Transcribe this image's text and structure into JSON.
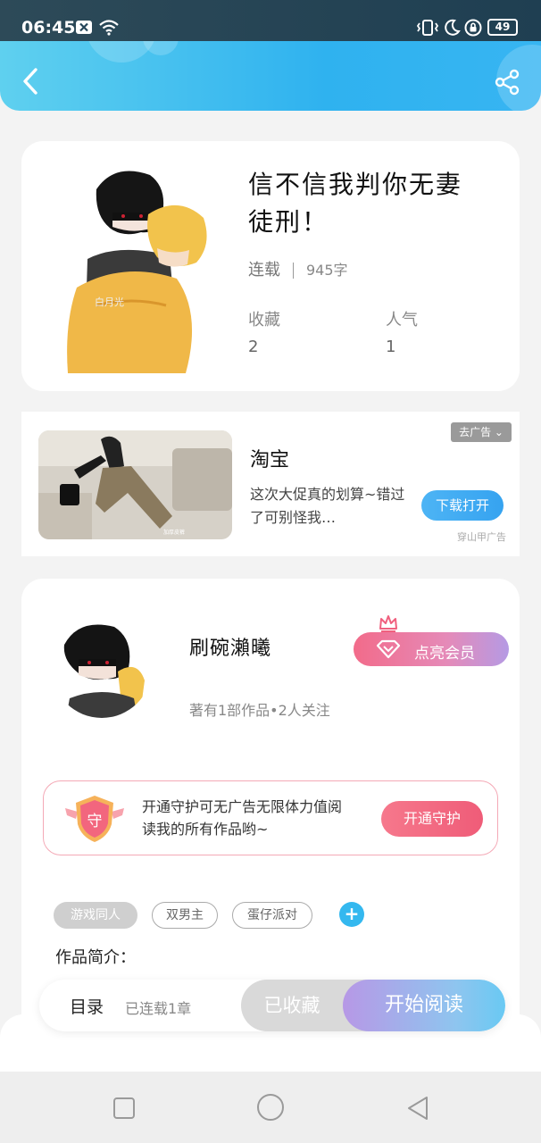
{
  "status_bar": {
    "time": "06:45",
    "battery": "49",
    "icons": [
      "close-box-icon",
      "wifi-icon",
      "vibrate-icon",
      "moon-icon",
      "lock-icon",
      "battery-icon"
    ]
  },
  "header": {
    "back_icon": "chevron-left-icon",
    "share_icon": "share-icon"
  },
  "book": {
    "title_line1": "信不信我判你无妻",
    "title_line2": "徒刑！",
    "status": "连载",
    "word_count": "945字",
    "favorites_label": "收藏",
    "favorites_value": "2",
    "popularity_label": "人气",
    "popularity_value": "1"
  },
  "ad": {
    "close_label": "去广告 ⌄",
    "title": "淘宝",
    "desc": "这次大促真的划算~错过了可别怪我…",
    "button": "下载打开",
    "source": "穿山甲广告"
  },
  "author": {
    "name": "刷碗瀨曦",
    "info": "著有1部作品•2人关注",
    "vip_button": "点亮会员",
    "guard_text": "开通守护可无广告无限体力值阅读我的所有作品哟~",
    "guard_button": "开通守护",
    "guard_badge": "守"
  },
  "tags": [
    "游戏同人",
    "双男主",
    "蛋仔派对"
  ],
  "intro_label": "作品简介：",
  "bottom_bar": {
    "toc": "目录",
    "toc_status": "已连载1章",
    "favorited": "已收藏",
    "start_reading": "开始阅读"
  },
  "colors": {
    "header_blue": "#2fb2ef",
    "accent_pink": "#ef5c78",
    "accent_purple": "#b798e6"
  }
}
